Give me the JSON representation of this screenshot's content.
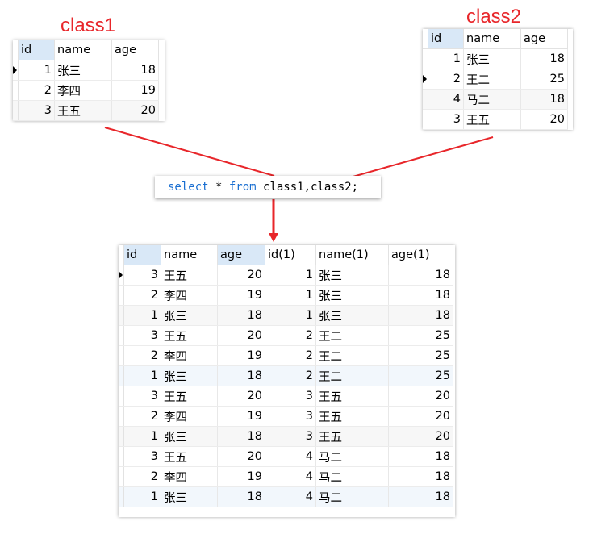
{
  "class1_label": "class1",
  "class2_label": "class2",
  "sql": {
    "kw_select": "select",
    "star": " * ",
    "kw_from": "from",
    "rest": " class1,class2;"
  },
  "class1": {
    "columns": [
      "id",
      "name",
      "age"
    ],
    "rows": [
      [
        "1",
        "张三",
        "18"
      ],
      [
        "2",
        "李四",
        "19"
      ],
      [
        "3",
        "王五",
        "20"
      ]
    ]
  },
  "class2": {
    "columns": [
      "id",
      "name",
      "age"
    ],
    "rows": [
      [
        "1",
        "张三",
        "18"
      ],
      [
        "2",
        "王二",
        "25"
      ],
      [
        "4",
        "马二",
        "18"
      ],
      [
        "3",
        "王五",
        "20"
      ]
    ]
  },
  "result": {
    "columns": [
      "id",
      "name",
      "age",
      "id(1)",
      "name(1)",
      "age(1)"
    ],
    "rows": [
      [
        "3",
        "王五",
        "20",
        "1",
        "张三",
        "18"
      ],
      [
        "2",
        "李四",
        "19",
        "1",
        "张三",
        "18"
      ],
      [
        "1",
        "张三",
        "18",
        "1",
        "张三",
        "18"
      ],
      [
        "3",
        "王五",
        "20",
        "2",
        "王二",
        "25"
      ],
      [
        "2",
        "李四",
        "19",
        "2",
        "王二",
        "25"
      ],
      [
        "1",
        "张三",
        "18",
        "2",
        "王二",
        "25"
      ],
      [
        "3",
        "王五",
        "20",
        "3",
        "王五",
        "20"
      ],
      [
        "2",
        "李四",
        "19",
        "3",
        "王五",
        "20"
      ],
      [
        "1",
        "张三",
        "18",
        "3",
        "王五",
        "20"
      ],
      [
        "3",
        "王五",
        "20",
        "4",
        "马二",
        "18"
      ],
      [
        "2",
        "李四",
        "19",
        "4",
        "马二",
        "18"
      ],
      [
        "1",
        "张三",
        "18",
        "4",
        "马二",
        "18"
      ]
    ]
  },
  "colors": {
    "red": "#e8262a",
    "keyword": "#1a6fd1",
    "header_highlight": "#d9e8f7"
  }
}
